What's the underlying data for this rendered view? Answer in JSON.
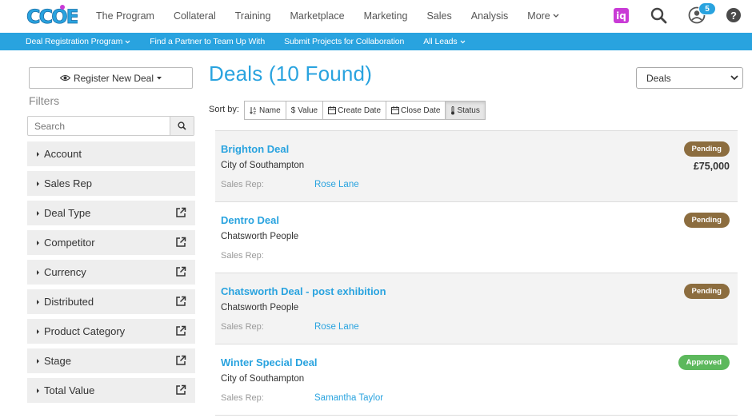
{
  "nav": {
    "logo_text": "CCOE",
    "links": [
      "The Program",
      "Collateral",
      "Training",
      "Marketplace",
      "Marketing",
      "Sales",
      "Analysis"
    ],
    "more_label": "More",
    "iq_label": "iq",
    "notification_count": "5",
    "help_label": "?"
  },
  "subnav": {
    "items": [
      "Deal Registration Program",
      "Find a Partner to Team Up With",
      "Submit Projects for Collaboration",
      "All Leads"
    ]
  },
  "sidebar": {
    "register_label": "Register New Deal",
    "filters_title": "Filters",
    "search_placeholder": "Search",
    "filters": [
      "Account",
      "Sales Rep",
      "Deal Type",
      "Competitor",
      "Currency",
      "Distributed",
      "Product Category",
      "Stage",
      "Total Value"
    ]
  },
  "main": {
    "title": "Deals (10 Found)",
    "view_select": "Deals",
    "sort_label": "Sort by:",
    "sort_options": [
      "Name",
      "Value",
      "Create Date",
      "Close Date",
      "Status"
    ],
    "rep_label": "Sales Rep:",
    "deals": [
      {
        "name": "Brighton Deal",
        "account": "City of Southampton",
        "rep": "Rose Lane",
        "status": "Pending",
        "value": "£75,000"
      },
      {
        "name": "Dentro Deal",
        "account": "Chatsworth People",
        "rep": "",
        "status": "Pending",
        "value": ""
      },
      {
        "name": "Chatsworth Deal - post exhibition",
        "account": "Chatsworth People",
        "rep": "Rose Lane",
        "status": "Pending",
        "value": ""
      },
      {
        "name": "Winter Special Deal",
        "account": "City of Southampton",
        "rep": "Samantha Taylor",
        "status": "Approved",
        "value": ""
      }
    ]
  },
  "colors": {
    "brand_blue": "#29a3df",
    "pending": "#8c6d3f",
    "approved": "#5cb85c",
    "iq_purple": "#c93bd6"
  }
}
